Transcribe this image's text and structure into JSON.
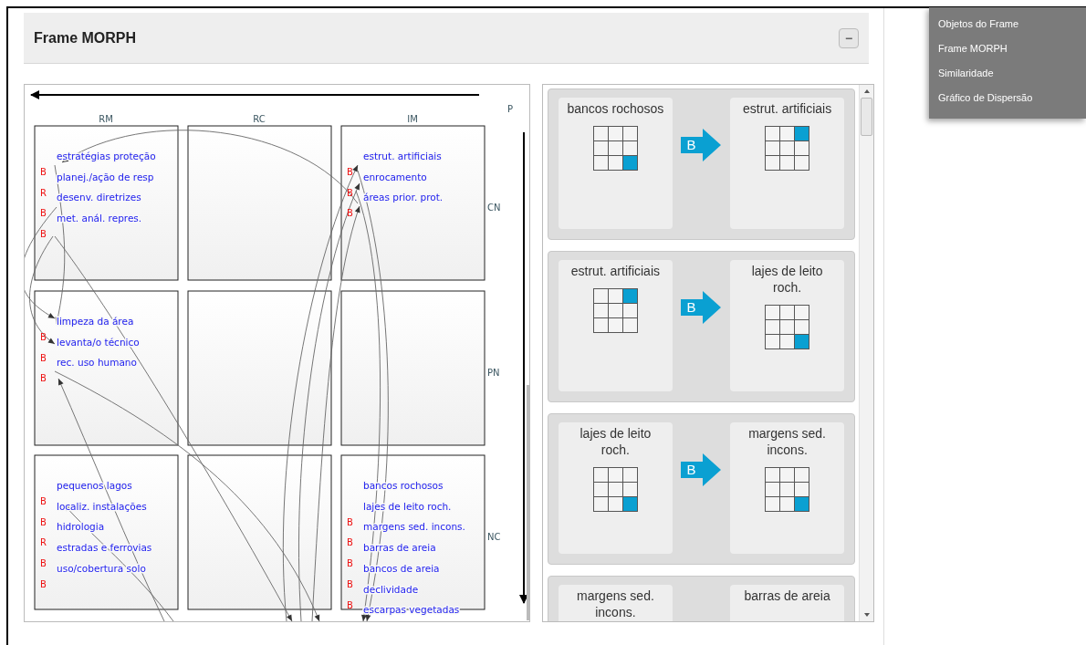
{
  "panel": {
    "title": "Frame MORPH",
    "collapse_label": "−"
  },
  "diagram": {
    "horizontal_axis": "P",
    "columns": [
      "RM",
      "RC",
      "IM"
    ],
    "rows": [
      {
        "label": "CN",
        "cells": [
          {
            "items": [
              {
                "text": "estratégias proteção",
                "marker": "B"
              },
              {
                "text": "planej./ação de resp",
                "marker": "R"
              },
              {
                "text": "desenv. diretrizes",
                "marker": "B"
              },
              {
                "text": "met. anál. repres.",
                "marker": "B"
              }
            ]
          },
          {},
          {
            "items": [
              {
                "text": "estrut. artificiais",
                "marker": "B"
              },
              {
                "text": "enrocamento",
                "marker": "B"
              },
              {
                "text": "áreas prior. prot.",
                "marker": "B"
              }
            ]
          }
        ]
      },
      {
        "label": "PN",
        "cells": [
          {
            "items": [
              {
                "text": "limpeza da área",
                "marker": "B"
              },
              {
                "text": "levanta/o técnico",
                "marker": "B"
              },
              {
                "text": "rec. uso humano",
                "marker": "B"
              }
            ]
          },
          {},
          {}
        ]
      },
      {
        "label": "NC",
        "cells": [
          {
            "items": [
              {
                "text": "pequenos lagos",
                "marker": "B"
              },
              {
                "text": "localiz. instalações",
                "marker": "B"
              },
              {
                "text": "hidrologia",
                "marker": "R"
              },
              {
                "text": "estradas e ferrovias",
                "marker": "B"
              },
              {
                "text": "uso/cobertura solo",
                "marker": "B"
              }
            ]
          },
          {},
          {
            "items": [
              {
                "text": "bancos rochosos"
              },
              {
                "text": "lajes de leito roch.",
                "marker": "B"
              },
              {
                "text": "margens sed. incons.",
                "marker": "B"
              },
              {
                "text": "barras de areia",
                "marker": "B"
              },
              {
                "text": "bancos de areia",
                "marker": "B"
              },
              {
                "text": "declividade",
                "marker": "B"
              },
              {
                "text": "escarpas vegetadas"
              }
            ]
          }
        ]
      }
    ]
  },
  "transitions": [
    {
      "from": {
        "label": "bancos rochosos",
        "grid": [
          [
            false,
            false,
            false
          ],
          [
            false,
            false,
            false
          ],
          [
            false,
            false,
            true
          ]
        ]
      },
      "relation": "B",
      "to": {
        "label": "estrut. artificiais",
        "grid": [
          [
            false,
            false,
            true
          ],
          [
            false,
            false,
            false
          ],
          [
            false,
            false,
            false
          ]
        ]
      }
    },
    {
      "from": {
        "label": "estrut. artificiais",
        "grid": [
          [
            false,
            false,
            true
          ],
          [
            false,
            false,
            false
          ],
          [
            false,
            false,
            false
          ]
        ]
      },
      "relation": "B",
      "to": {
        "label": "lajes de leito roch.",
        "grid": [
          [
            false,
            false,
            false
          ],
          [
            false,
            false,
            false
          ],
          [
            false,
            false,
            true
          ]
        ]
      }
    },
    {
      "from": {
        "label": "lajes de leito roch.",
        "grid": [
          [
            false,
            false,
            false
          ],
          [
            false,
            false,
            false
          ],
          [
            false,
            false,
            true
          ]
        ]
      },
      "relation": "B",
      "to": {
        "label": "margens sed. incons.",
        "grid": [
          [
            false,
            false,
            false
          ],
          [
            false,
            false,
            false
          ],
          [
            false,
            false,
            true
          ]
        ]
      }
    },
    {
      "from": {
        "label": "margens sed. incons."
      },
      "to": {
        "label": "barras de areia"
      }
    }
  ],
  "menu": [
    {
      "label": "Objetos do Frame"
    },
    {
      "label": "Frame MORPH"
    },
    {
      "label": "Similaridade"
    },
    {
      "label": "Gráfico de Dispersão"
    }
  ]
}
